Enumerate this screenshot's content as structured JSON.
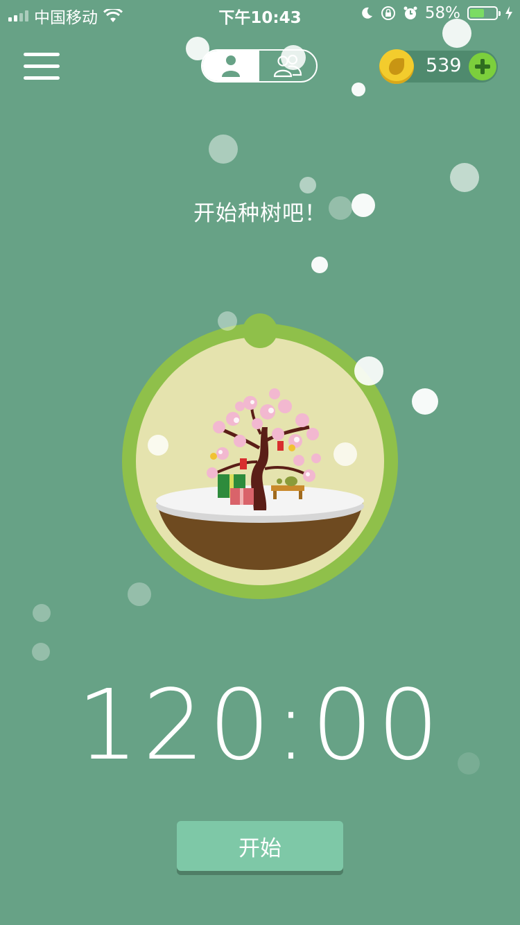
{
  "status_bar": {
    "carrier": "中国移动",
    "time": "下午10:43",
    "battery_percent": "58%",
    "battery_level": 0.58
  },
  "header": {
    "menu_icon": "hamburger-menu-icon",
    "mode_toggle": {
      "options": [
        "single-user-icon",
        "group-users-icon"
      ],
      "selected": 0
    },
    "coins": "539",
    "add_icon": "plus-icon"
  },
  "main": {
    "prompt": "开始种树吧！",
    "timer": "120:00",
    "start_label": "开始"
  },
  "colors": {
    "background": "#67a286",
    "ring": "#8fc04a",
    "button": "#7ec8a7"
  }
}
